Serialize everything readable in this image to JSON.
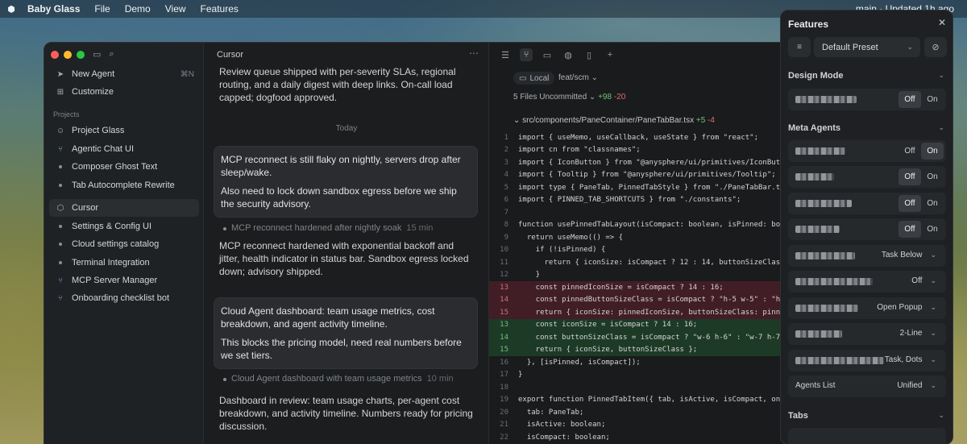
{
  "menubar": {
    "app": "Baby Glass",
    "items": [
      "File",
      "Demo",
      "View",
      "Features"
    ],
    "right": "main · Updated 1h ago"
  },
  "sidebar": {
    "new_agent": "New Agent",
    "new_agent_shortcut": "⌘N",
    "customize": "Customize",
    "projects_heading": "Projects",
    "items": [
      {
        "label": "Project Glass"
      },
      {
        "label": "Agentic Chat UI"
      },
      {
        "label": "Composer Ghost Text"
      },
      {
        "label": "Tab Autocomplete Rewrite"
      },
      {
        "label": "Cursor"
      },
      {
        "label": "Settings & Config UI"
      },
      {
        "label": "Cloud settings catalog"
      },
      {
        "label": "Terminal Integration"
      },
      {
        "label": "MCP Server Manager"
      },
      {
        "label": "Onboarding checklist bot"
      }
    ]
  },
  "chat": {
    "header": "Cursor",
    "msg1": "Review queue shipped with per-severity SLAs, regional routing, and a daily digest with deep links. On-call load capped; dogfood approved.",
    "today": "Today",
    "bubble1_p1": "MCP reconnect is still flaky on nightly, servers drop after sleep/wake.",
    "bubble1_p2": "Also need to lock down sandbox egress before we ship the security advisory.",
    "status1": "MCP reconnect hardened after nightly soak",
    "status1_time": "15 min",
    "msg2": "MCP reconnect hardened with exponential backoff and jitter, health indicator in status bar. Sandbox egress locked down; advisory shipped.",
    "bubble2_p1": "Cloud Agent dashboard: team usage metrics, cost breakdown, and agent activity timeline.",
    "bubble2_p2": "This blocks the pricing model, need real numbers before we set tiers.",
    "status2": "Cloud Agent dashboard with team usage metrics",
    "status2_time": "10 min",
    "msg3": "Dashboard in review: team usage charts, per-agent cost breakdown, and activity timeline. Numbers ready for pricing discussion."
  },
  "code": {
    "local": "Local",
    "branch": "feat/scm ⌄",
    "uncommitted": "5 Files Uncommitted ⌄",
    "uncommitted_add": "+98",
    "uncommitted_del": "-20",
    "file": "src/components/PaneContainer/PaneTabBar.tsx",
    "file_add": "+5",
    "file_del": "-4",
    "lines": [
      {
        "n": "1",
        "t": "import { useMemo, useCallback, useState } from \"react\";",
        "k": ""
      },
      {
        "n": "2",
        "t": "import cn from \"classnames\";",
        "k": ""
      },
      {
        "n": "3",
        "t": "import { IconButton } from \"@anysphere/ui/primitives/IconButton",
        "k": ""
      },
      {
        "n": "4",
        "t": "import { Tooltip } from \"@anysphere/ui/primitives/Tooltip\";",
        "k": ""
      },
      {
        "n": "5",
        "t": "import type { PaneTab, PinnedTabStyle } from \"./PaneTabBar.type",
        "k": ""
      },
      {
        "n": "6",
        "t": "import { PINNED_TAB_SHORTCUTS } from \"./constants\";",
        "k": ""
      },
      {
        "n": "7",
        "t": "",
        "k": ""
      },
      {
        "n": "8",
        "t": "function usePinnedTabLayout(isCompact: boolean, isPinned: boole",
        "k": ""
      },
      {
        "n": "9",
        "t": "  return useMemo(() => {",
        "k": ""
      },
      {
        "n": "10",
        "t": "    if (!isPinned) {",
        "k": ""
      },
      {
        "n": "11",
        "t": "      return { iconSize: isCompact ? 12 : 14, buttonSizeClass:",
        "k": ""
      },
      {
        "n": "12",
        "t": "    }",
        "k": ""
      },
      {
        "n": "13",
        "t": "    const pinnedIconSize = isCompact ? 14 : 16;",
        "k": "rm"
      },
      {
        "n": "14",
        "t": "    const pinnedButtonSizeClass = isCompact ? \"h-5 w-5\" : \"h-6",
        "k": "rm"
      },
      {
        "n": "15",
        "t": "    return { iconSize: pinnedIconSize, buttonSizeClass: pinnedB",
        "k": "rm"
      },
      {
        "n": "13",
        "t": "    const iconSize = isCompact ? 14 : 16;",
        "k": "ad"
      },
      {
        "n": "14",
        "t": "    const buttonSizeClass = isCompact ? \"w-6 h-6\" : \"w-7 h-7\";",
        "k": "ad"
      },
      {
        "n": "15",
        "t": "    return { iconSize, buttonSizeClass };",
        "k": "ad"
      },
      {
        "n": "16",
        "t": "  }, [isPinned, isCompact]);",
        "k": ""
      },
      {
        "n": "17",
        "t": "}",
        "k": ""
      },
      {
        "n": "18",
        "t": "",
        "k": ""
      },
      {
        "n": "19",
        "t": "export function PinnedTabItem({ tab, isActive, isCompact, onTab",
        "k": ""
      },
      {
        "n": "20",
        "t": "  tab: PaneTab;",
        "k": ""
      },
      {
        "n": "21",
        "t": "  isActive: boolean;",
        "k": ""
      },
      {
        "n": "22",
        "t": "  isCompact: boolean;",
        "k": ""
      }
    ]
  },
  "features": {
    "title": "Features",
    "preset": "Default Preset",
    "design_mode": "Design Mode",
    "meta_agents": "Meta Agents",
    "seg_off": "Off",
    "seg_on": "On",
    "dd_task_below": "Task Below",
    "dd_off": "Off",
    "dd_open_popup": "Open Popup",
    "dd_two_line": "2-Line",
    "dd_task_dots": "Task, Dots",
    "agents_list_label": "Agents List",
    "agents_list_value": "Unified",
    "tabs": "Tabs"
  },
  "colors": {
    "added": "#6fc275",
    "removed": "#e06c6c",
    "accent_purple": "#a28bd8",
    "accent_green": "#6fbf73"
  }
}
